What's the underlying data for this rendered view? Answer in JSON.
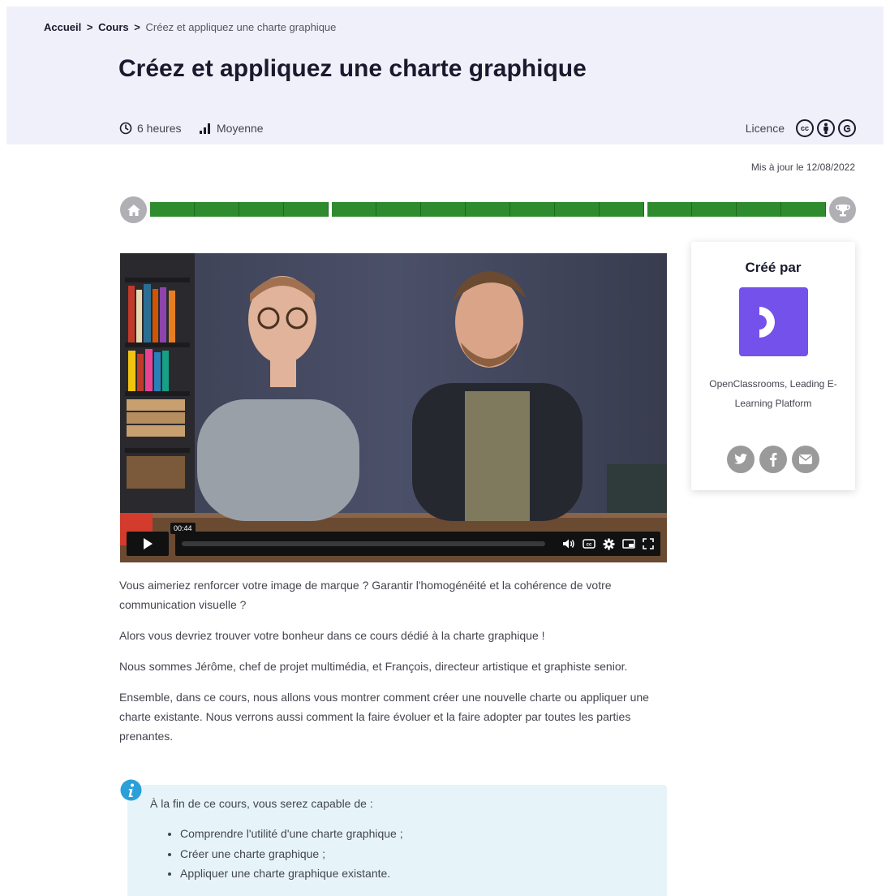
{
  "breadcrumb": {
    "home": "Accueil",
    "separator1": ">",
    "courses": "Cours",
    "separator2": ">",
    "current": "Créez et appliquez une charte graphique"
  },
  "course": {
    "title": "Créez et appliquez une charte graphique",
    "duration": "6 heures",
    "level": "Moyenne",
    "licence_label": "Licence",
    "licence_icons": [
      "cc",
      "by",
      "nd"
    ],
    "updated": "Mis à jour le 12/08/2022"
  },
  "progress": {
    "parts": [
      4,
      7,
      4
    ],
    "completed_fraction": 1.0,
    "start_icon": "home-icon",
    "end_icon": "trophy-icon",
    "color": "#2e8b2e"
  },
  "video": {
    "timestamp_tooltip": "00:44",
    "controls": [
      "play-icon",
      "volume-icon",
      "captions-icon",
      "settings-icon",
      "picture-in-picture-icon",
      "fullscreen-icon"
    ]
  },
  "author": {
    "heading": "Créé par",
    "name": "OpenClassrooms, Leading E-Learning Platform",
    "logo_color": "#7451eb",
    "share": [
      "twitter-icon",
      "facebook-icon",
      "email-icon"
    ]
  },
  "intro": {
    "paragraphs": [
      "Vous aimeriez renforcer votre image de marque ? Garantir l'homogénéité et la cohérence de votre communication visuelle ?",
      "Alors vous devriez trouver votre bonheur dans ce cours dédié à la charte graphique !",
      "Nous sommes Jérôme, chef de projet multimédia, et François, directeur artistique et graphiste senior.",
      "Ensemble, dans ce cours, nous allons vous montrer comment créer une nouvelle charte ou appliquer une charte existante. Nous verrons aussi comment la faire évoluer et la faire adopter par toutes les parties prenantes."
    ]
  },
  "objectives": {
    "lead": "À la fin de ce cours, vous serez capable de :",
    "items": [
      "Comprendre l'utilité d'une charte graphique ;",
      "Créer une charte graphique ;",
      "Appliquer une charte graphique existante."
    ]
  }
}
